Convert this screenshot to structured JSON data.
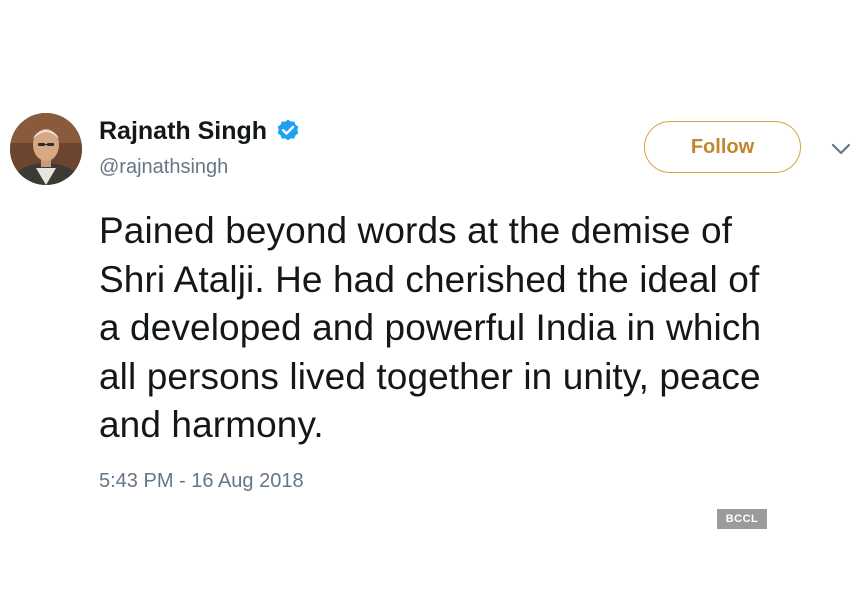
{
  "tweet": {
    "author": {
      "display_name": "Rajnath Singh",
      "handle": "@rajnathsingh",
      "verified_icon": "verified-badge-icon"
    },
    "follow_label": "Follow",
    "more_icon": "chevron-down-icon",
    "text": "Pained beyond words at the demise of\nShri Atalji. He had cherished the ideal of\na developed and powerful India in which\nall persons lived together in unity, peace\nand harmony.",
    "timestamp": "5:43 PM - 16 Aug 2018"
  },
  "watermark": "BCCL",
  "colors": {
    "verified": "#1da1f2",
    "follow_text": "#c2862b",
    "follow_border": "#d4a44a",
    "secondary_text": "#657786"
  }
}
